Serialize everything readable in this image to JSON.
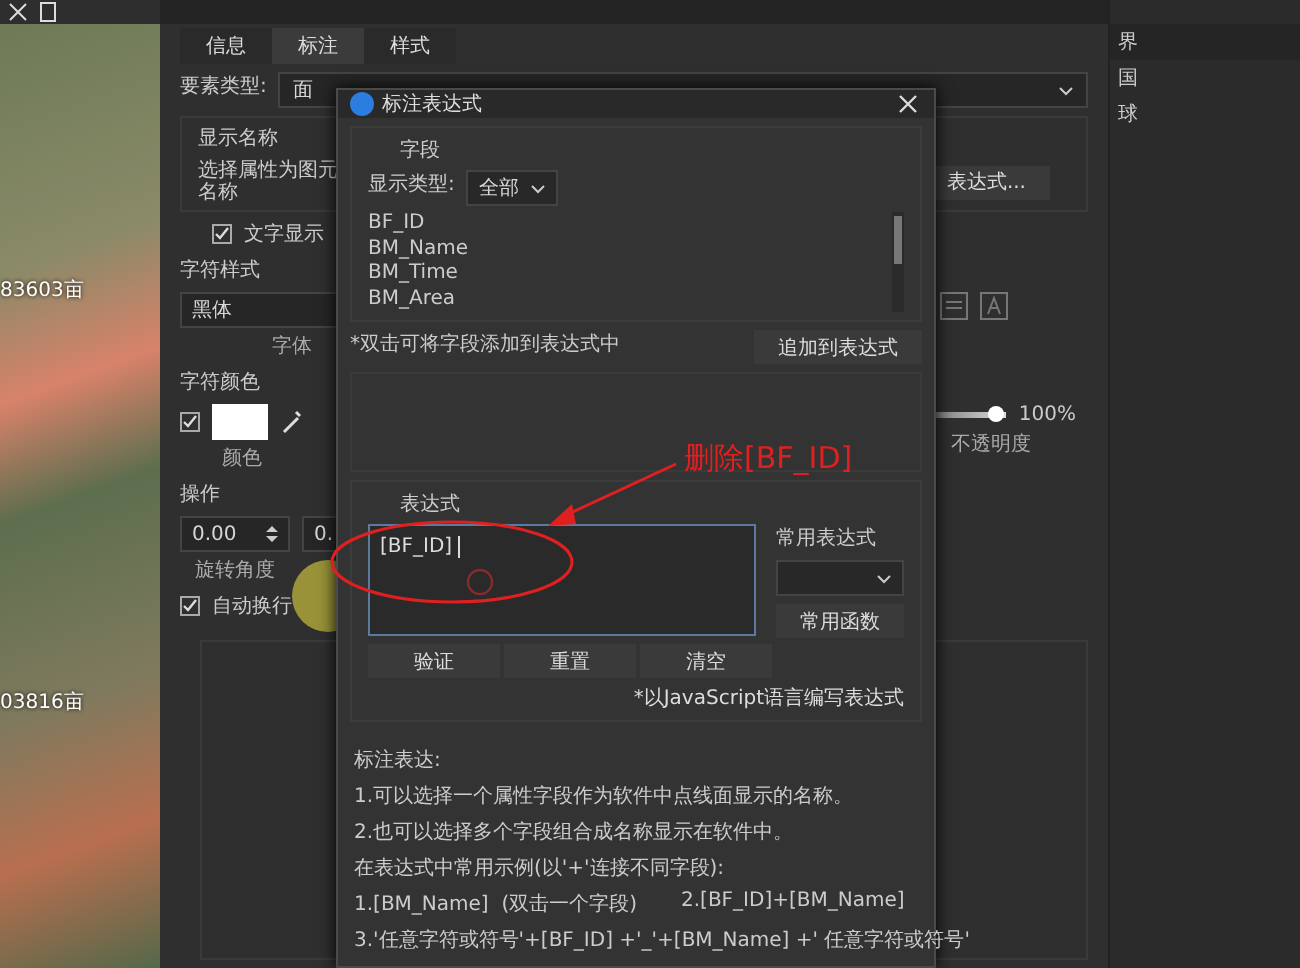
{
  "map": {
    "labels": [
      "83603亩",
      "03816亩"
    ]
  },
  "properties": {
    "tabs": [
      {
        "label": "信息",
        "selected": false
      },
      {
        "label": "标注",
        "selected": true
      },
      {
        "label": "样式",
        "selected": false
      }
    ],
    "feature_type": {
      "label": "要素类型:",
      "value": "面"
    },
    "display_name": {
      "title": "显示名称",
      "label": "选择属性为图元名称",
      "button": "表达式..."
    },
    "text_display": {
      "label": "文字显示",
      "checked": true
    },
    "font_style": {
      "title": "字符样式",
      "value": "黑体",
      "caption": "字体"
    },
    "font_color": {
      "title": "字符颜色",
      "checked": true,
      "caption": "颜色",
      "opacity": {
        "level": 0.9,
        "reading": "100%",
        "caption": "不透明度"
      }
    },
    "operation": {
      "title": "操作",
      "rotation": "0.00",
      "caption": "旋转角度",
      "second": "0."
    },
    "auto_wrap": {
      "label": "自动换行",
      "checked": true
    }
  },
  "side_panel": {
    "items": [
      "界",
      "国",
      "球"
    ]
  },
  "dialog": {
    "title": "标注表达式",
    "fields": {
      "title": "字段",
      "type_label": "显示类型:",
      "type_value": "全部",
      "items": [
        "BF_ID",
        "BM_Name",
        "BM_Time",
        "BM_Area"
      ],
      "hint": "*双击可将字段添加到表达式中",
      "add_button": "追加到表达式"
    },
    "expression": {
      "title": "表达式",
      "value": "[BF_ID]",
      "common_label": "常用表达式",
      "functions_button": "常用函数",
      "buttons": [
        "验证",
        "重置",
        "清空"
      ],
      "note": "*以JavaScript语言编写表达式"
    },
    "help": {
      "title": "标注表达:",
      "lines": [
        [
          "1.可以选择一个属性字段作为软件中点线面显示的名称。"
        ],
        [
          "2.也可以选择多个字段组合成名称显示在软件中。"
        ],
        [
          "在表达式中常用示例(以'+'连接不同字段):"
        ],
        [
          "1.[BM_Name]  (双击一个字段)",
          "2.[BF_ID]+[BM_Name]"
        ],
        [
          "3.'任意字符或符号'+[BF_ID] +'_'+[BM_Name] +' 任意字符或符号'"
        ]
      ]
    }
  },
  "annotation": {
    "text": "删除[BF_ID]"
  }
}
